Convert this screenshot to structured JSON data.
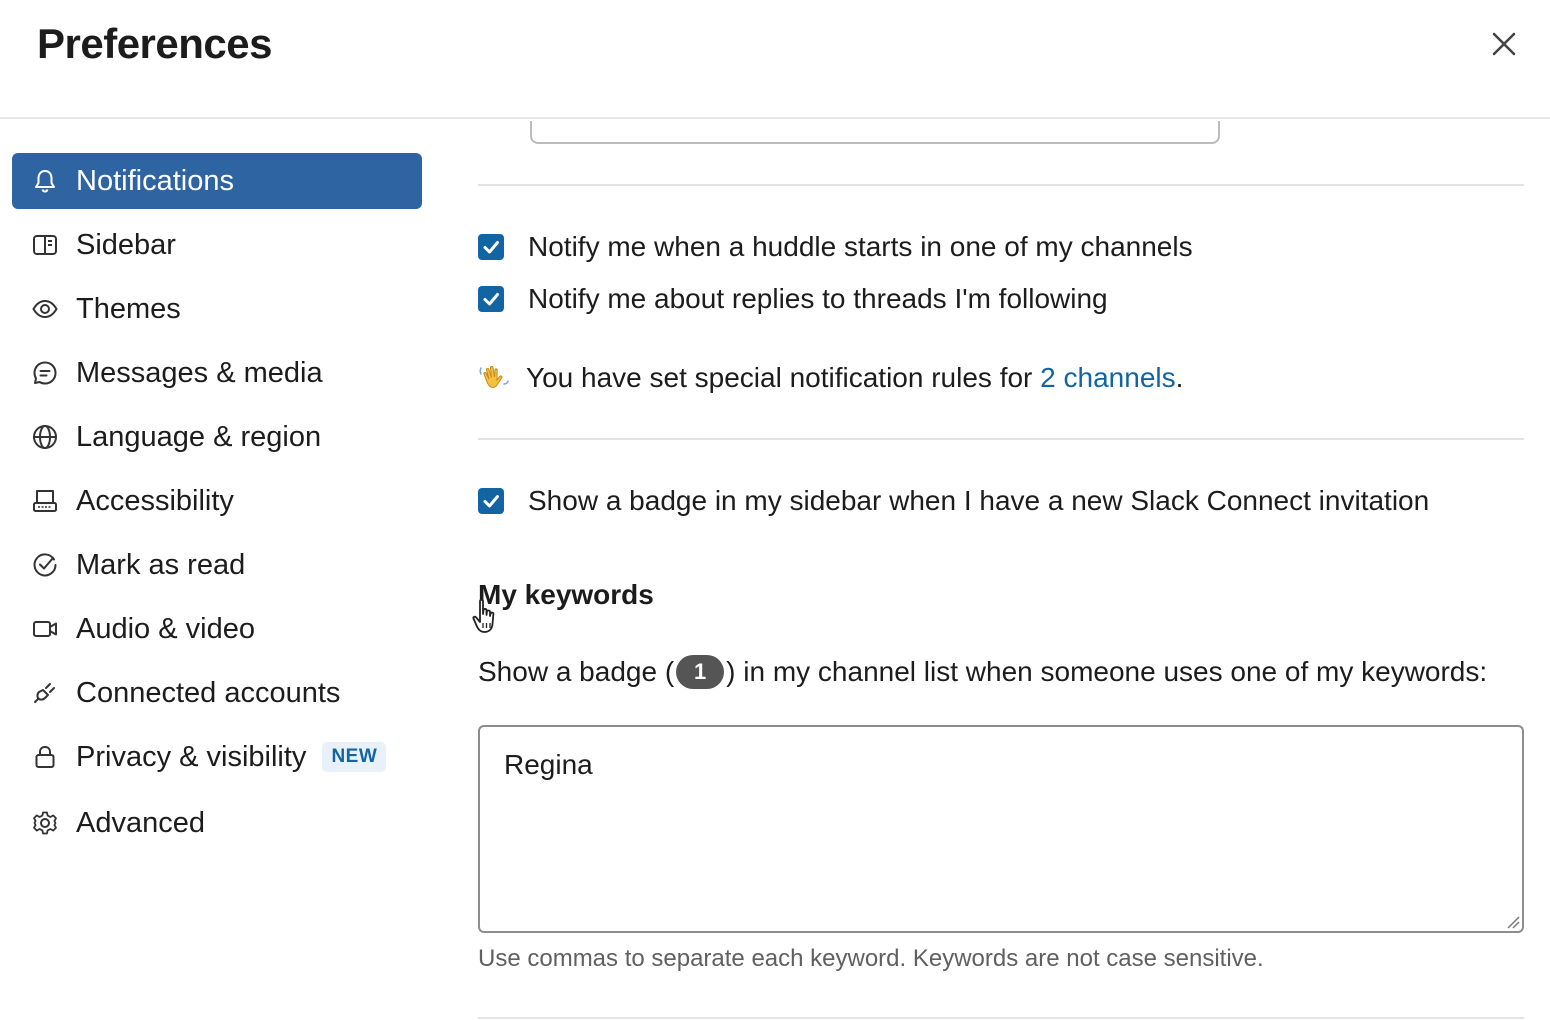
{
  "window": {
    "title": "Preferences",
    "close_icon": "close-icon"
  },
  "sidebar": {
    "items": [
      {
        "label": "Notifications",
        "icon": "bell-icon",
        "active": true
      },
      {
        "label": "Sidebar",
        "icon": "sidebar-icon",
        "active": false
      },
      {
        "label": "Themes",
        "icon": "eye-icon",
        "active": false
      },
      {
        "label": "Messages & media",
        "icon": "message-icon",
        "active": false
      },
      {
        "label": "Language & region",
        "icon": "globe-icon",
        "active": false
      },
      {
        "label": "Accessibility",
        "icon": "keyboard-icon",
        "active": false
      },
      {
        "label": "Mark as read",
        "icon": "check-circle-icon",
        "active": false
      },
      {
        "label": "Audio & video",
        "icon": "video-icon",
        "active": false
      },
      {
        "label": "Connected accounts",
        "icon": "plug-icon",
        "active": false
      },
      {
        "label": "Privacy & visibility",
        "icon": "lock-icon",
        "active": false,
        "badge": "NEW"
      },
      {
        "label": "Advanced",
        "icon": "gear-icon",
        "active": false
      }
    ]
  },
  "main": {
    "huddle_checkbox": {
      "label": "Notify me when a huddle starts in one of my channels",
      "checked": true
    },
    "threads_checkbox": {
      "label": "Notify me about replies to threads I'm following",
      "checked": true
    },
    "special_rules": {
      "prefix": "You have set special notification rules for ",
      "link": "2 channels",
      "suffix": ".",
      "icon": "waving-hand-icon"
    },
    "connect_checkbox": {
      "label": "Show a badge in my sidebar when I have a new Slack Connect invitation",
      "checked": true
    },
    "keywords": {
      "title": "My keywords",
      "desc_prefix": "Show a badge (",
      "badge_count": "1",
      "desc_suffix": ") in my channel list when someone uses one of my keywords:",
      "value": "Regina",
      "hint": "Use commas to separate each keyword. Keywords are not case sensitive."
    }
  },
  "colors": {
    "accent": "#2f64a3",
    "checkbox": "#1264a3",
    "link": "#1264a3"
  }
}
